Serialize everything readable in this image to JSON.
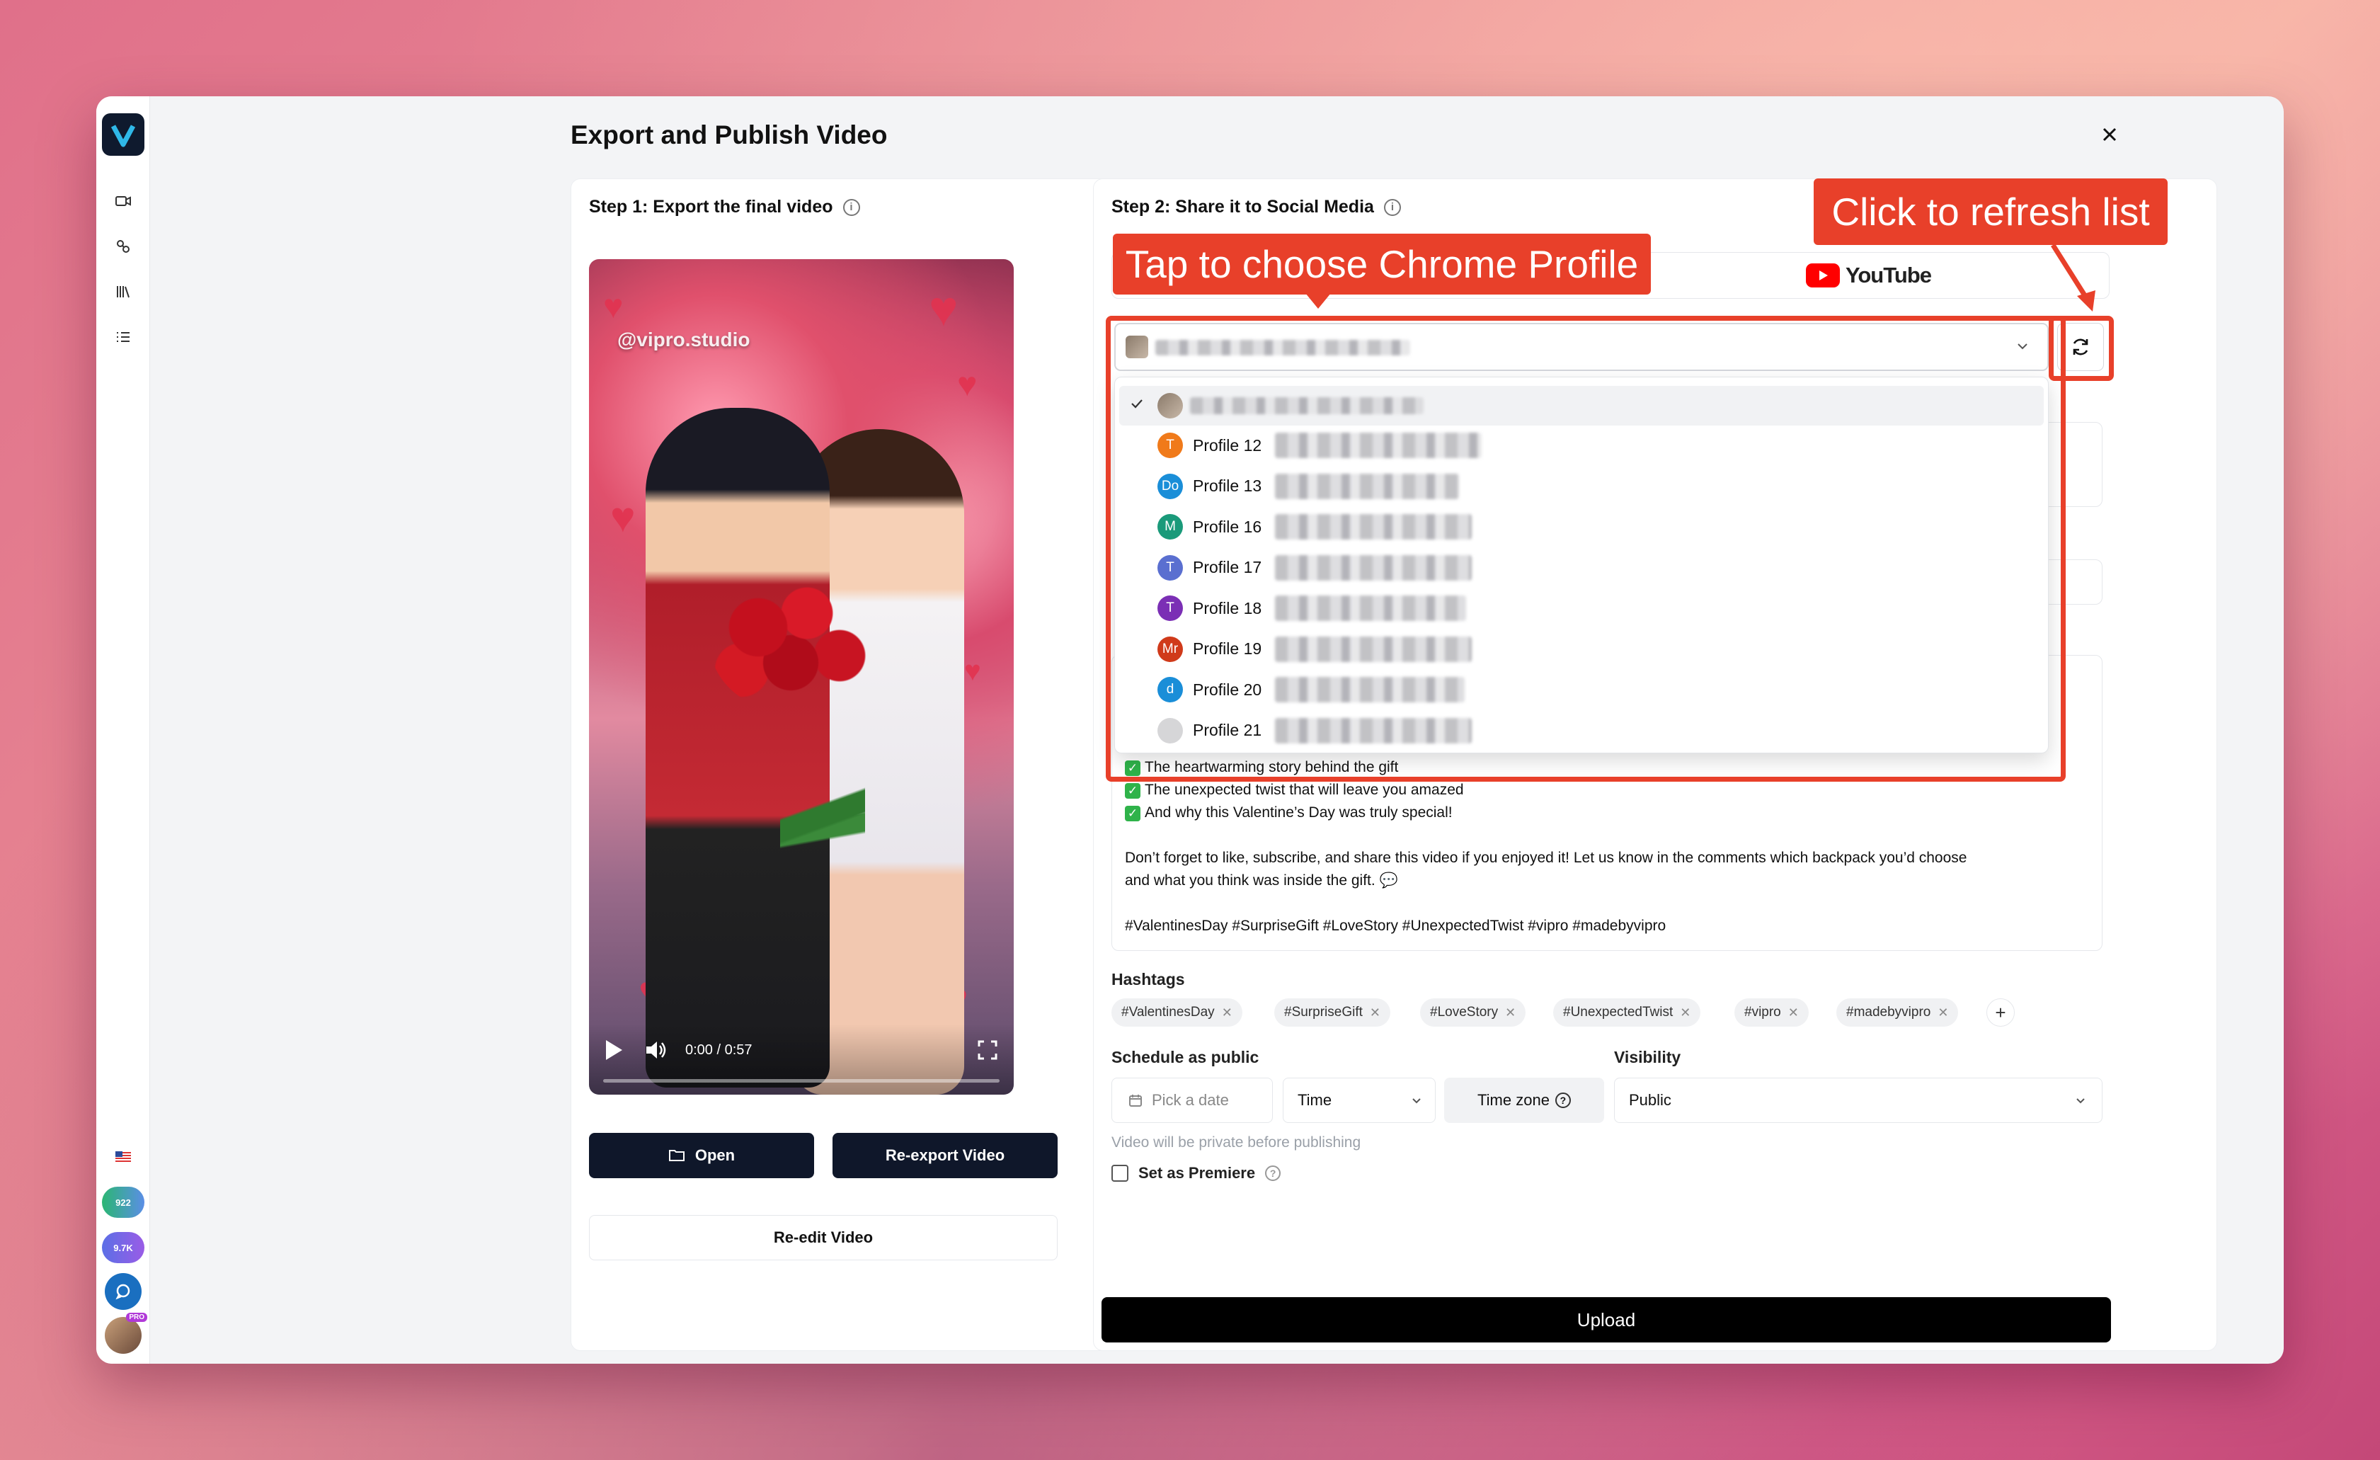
{
  "dialog": {
    "title": "Export and Publish Video"
  },
  "step1": {
    "title": "Step 1: Export the final video",
    "video": {
      "watermark": "@vipro.studio",
      "time": "0:00 / 0:57",
      "progress_fraction": 0
    },
    "open_label": "Open",
    "reexport_label": "Re-export Video",
    "reedit_label": "Re-edit Video"
  },
  "step2": {
    "title": "Step 2: Share it to Social Media",
    "platform_tab": "YouTube",
    "profile_options": [
      {
        "label": "Profile 12",
        "initials": "T",
        "color": "#f07a1a"
      },
      {
        "label": "Profile 13",
        "initials": "Do",
        "color": "#1a8ed8"
      },
      {
        "label": "Profile 16",
        "initials": "M",
        "color": "#1a9a7a"
      },
      {
        "label": "Profile 17",
        "initials": "T",
        "color": "#5a6fd0"
      },
      {
        "label": "Profile 18",
        "initials": "T",
        "color": "#7b2fb5"
      },
      {
        "label": "Profile 19",
        "initials": "Mr",
        "color": "#d03a1a"
      },
      {
        "label": "Profile 20",
        "initials": "d",
        "color": "#1a8ed8"
      },
      {
        "label": "Profile 21",
        "initials": "",
        "color": "#d6d6d8"
      }
    ],
    "description_lines": [
      "The heartwarming story behind the gift",
      "The unexpected twist that will leave you amazed",
      "And why this Valentine’s Day was truly special!",
      "Don’t forget to like, subscribe, and share this video if you enjoyed it! Let us know in the comments which backpack you’d choose",
      "and what you think was inside the gift. 💬",
      "#ValentinesDay #SurpriseGift #LoveStory #UnexpectedTwist #vipro #madebyvipro"
    ],
    "hashtags_label": "Hashtags",
    "hashtags": [
      "#ValentinesDay",
      "#SurpriseGift",
      "#LoveStory",
      "#UnexpectedTwist",
      "#vipro",
      "#madebyvipro"
    ],
    "schedule_label": "Schedule as public",
    "date_placeholder": "Pick a date",
    "time_placeholder": "Time",
    "timezone_label": "Time zone",
    "visibility_label": "Visibility",
    "visibility_value": "Public",
    "private_note": "Video will be private before publishing",
    "premiere_label": "Set as Premiere",
    "upload_label": "Upload"
  },
  "annotations": {
    "choose_profile": "Tap to choose Chrome Profile",
    "refresh_list": "Click to refresh list",
    "accent_color": "#e8402a"
  },
  "rail": {
    "badge1": "922",
    "badge2": "9.7K",
    "pro": "PRO"
  }
}
